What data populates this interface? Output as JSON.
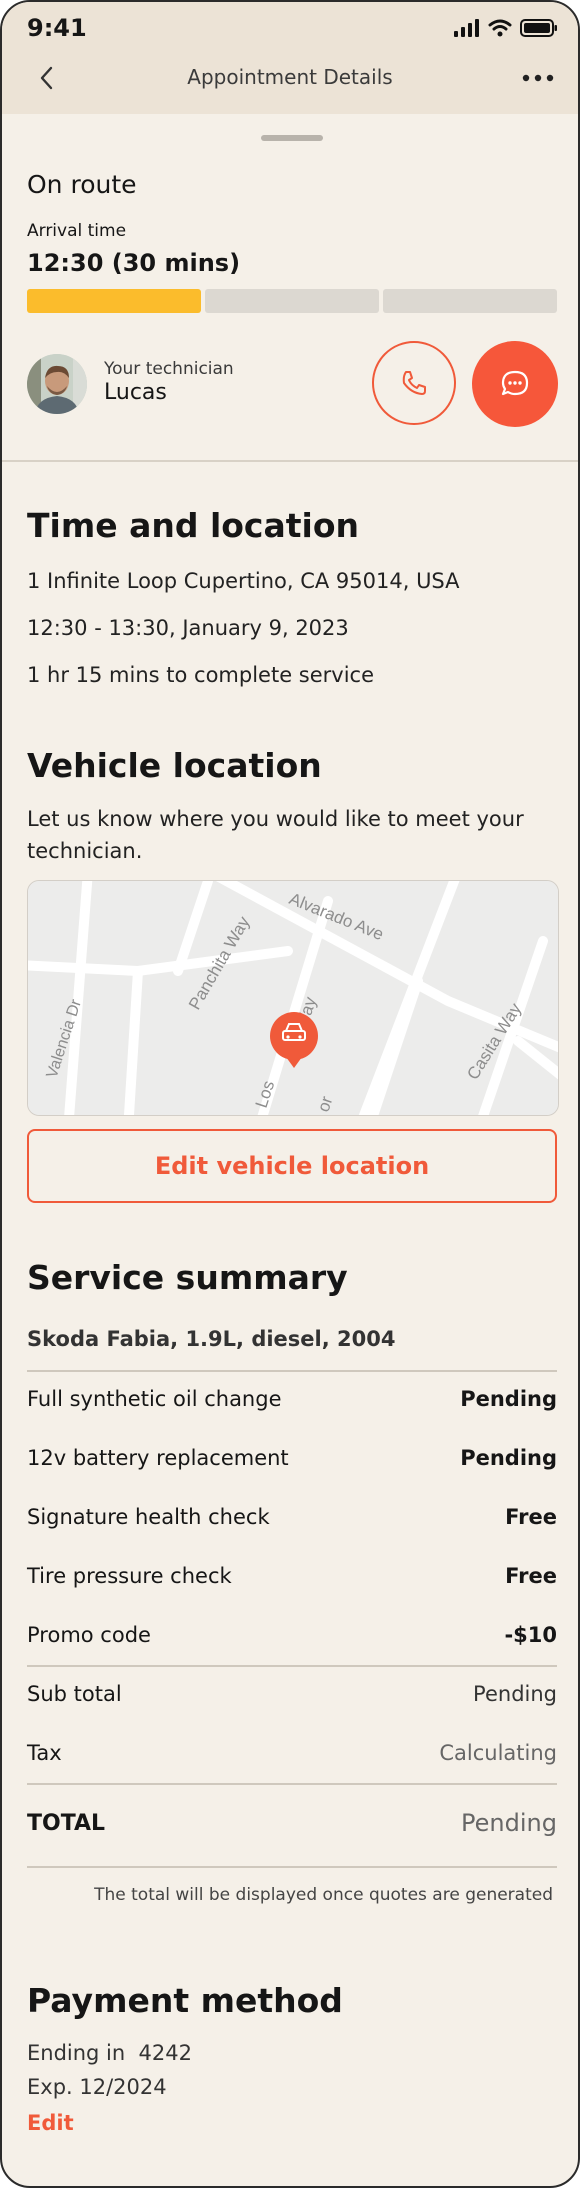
{
  "status_bar": {
    "time": "9:41"
  },
  "nav": {
    "title": "Appointment Details"
  },
  "tracking": {
    "status": "On route",
    "arrival_label": "Arrival time",
    "arrival_value": "12:30 (30 mins)",
    "progress_fraction": 0.33
  },
  "technician": {
    "label": "Your technician",
    "name": "Lucas"
  },
  "colors": {
    "accent": "#f6573a",
    "progress": "#fbbc2c",
    "background": "#f5f0e8",
    "header": "#ece3d6"
  },
  "time_location": {
    "heading": "Time and location",
    "address": "1 Infinite Loop Cupertino, CA 95014, USA",
    "time_range": "12:30 - 13:30, January 9, 2023",
    "duration": "1 hr 15 mins to complete service"
  },
  "vehicle_location": {
    "heading": "Vehicle location",
    "description_1": "Let us know where you would like to meet your",
    "description_2": "technician.",
    "streets": [
      "Panchita Way",
      "Alvarado Ave",
      "Valencia Dr",
      "Los",
      "Way",
      "Casita Way",
      "or"
    ],
    "edit_button": "Edit vehicle location"
  },
  "service_summary": {
    "heading": "Service summary",
    "vehicle": "Skoda Fabia, 1.9L, diesel, 2004",
    "items": [
      {
        "label": "Full synthetic oil change",
        "value": "Pending"
      },
      {
        "label": "12v battery replacement",
        "value": "Pending"
      },
      {
        "label": "Signature health check",
        "value": "Free"
      },
      {
        "label": "Tire pressure check",
        "value": "Free"
      },
      {
        "label": "Promo code",
        "value": "-$10"
      }
    ],
    "subtotal_label": "Sub total",
    "subtotal_value": "Pending",
    "tax_label": "Tax",
    "tax_value": "Calculating",
    "total_label": "TOTAL",
    "total_value": "Pending",
    "note": "The total will be displayed once quotes are generated"
  },
  "payment": {
    "heading": "Payment method",
    "ending": "Ending in  4242",
    "expiry": "Exp. 12/2024",
    "edit": "Edit"
  }
}
